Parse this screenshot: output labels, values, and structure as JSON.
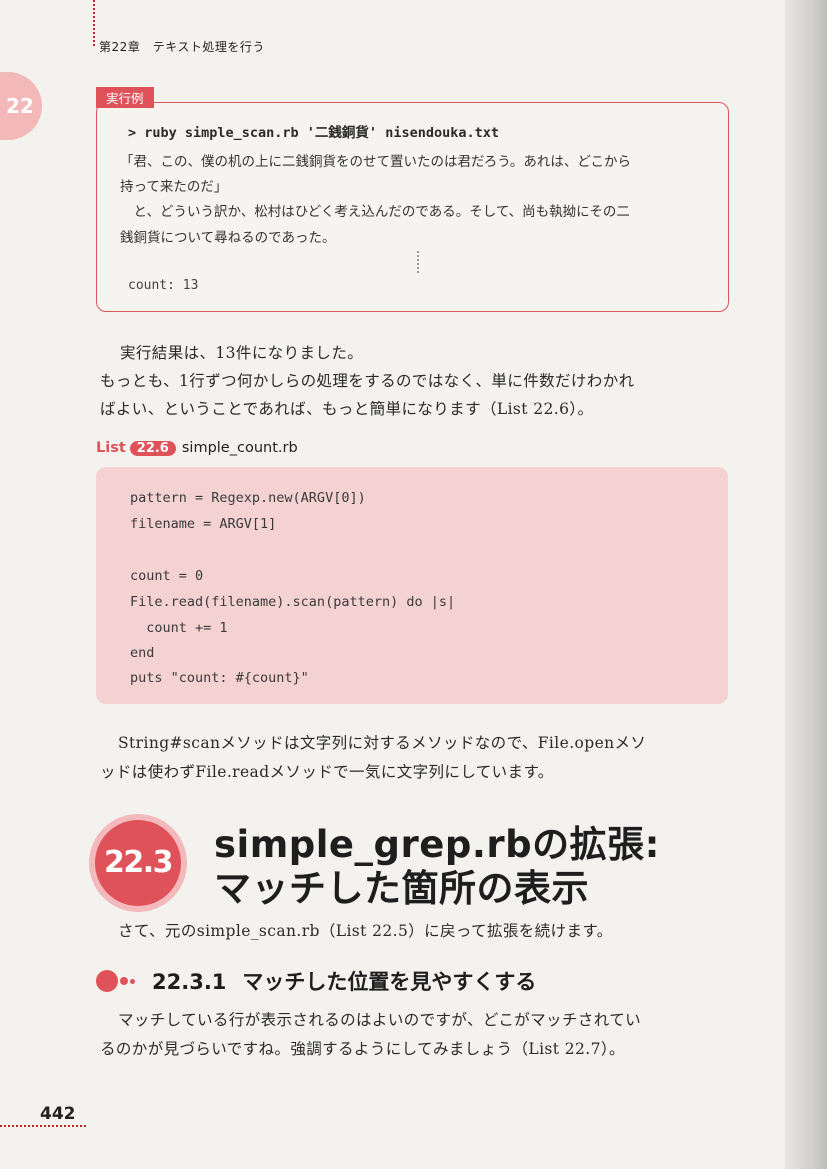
{
  "header": {
    "chapter": "第22章　テキスト処理を行う",
    "chapter_tab": "22"
  },
  "exec": {
    "label": "実行例",
    "command": "> ruby simple_scan.rb '二銭銅貨' nisendouka.txt",
    "lines": [
      "「君、この、僕の机の上に二銭銅貨をのせて置いたのは君だろう。あれは、どこから",
      "持って来たのだ」",
      "　と、どういう訳か、松村はひどく考え込んだのである。そして、尚も執拗にその二",
      "銭銅貨について尋ねるのであった。"
    ],
    "count": "count: 13"
  },
  "para1": {
    "lines": [
      "実行結果は、13件になりました。",
      "もっとも、1行ずつ何かしらの処理をするのではなく、単に件数だけわかれ",
      "ばよい、ということであれば、もっと簡単になります（List 22.6）。"
    ]
  },
  "list": {
    "label": "List",
    "number": "22.6",
    "title": "simple_count.rb",
    "code": [
      "pattern = Regexp.new(ARGV[0])",
      "filename = ARGV[1]",
      "",
      "count = 0",
      "File.read(filename).scan(pattern) do |s|",
      "  count += 1",
      "end",
      "puts \"count: #{count}\""
    ]
  },
  "para2": {
    "lines": [
      "String#scanメソッドは文字列に対するメソッドなので、File.openメソ",
      "ッドは使わずFile.readメソッドで一気に文字列にしています。"
    ]
  },
  "section": {
    "number": "22.3",
    "title_line1": "simple_grep.rbの拡張:",
    "title_line2": "マッチした箇所の表示"
  },
  "para3": {
    "text": "さて、元のsimple_scan.rb（List 22.5）に戻って拡張を続けます。"
  },
  "subsection": {
    "number": "22.3.1",
    "title": "マッチした位置を見やすくする"
  },
  "para4": {
    "lines": [
      "マッチしている行が表示されるのはよいのですが、どこがマッチされてい",
      "るのかが見づらいですね。強調するようにしてみましょう（List 22.7）。"
    ]
  },
  "page_number": "442"
}
